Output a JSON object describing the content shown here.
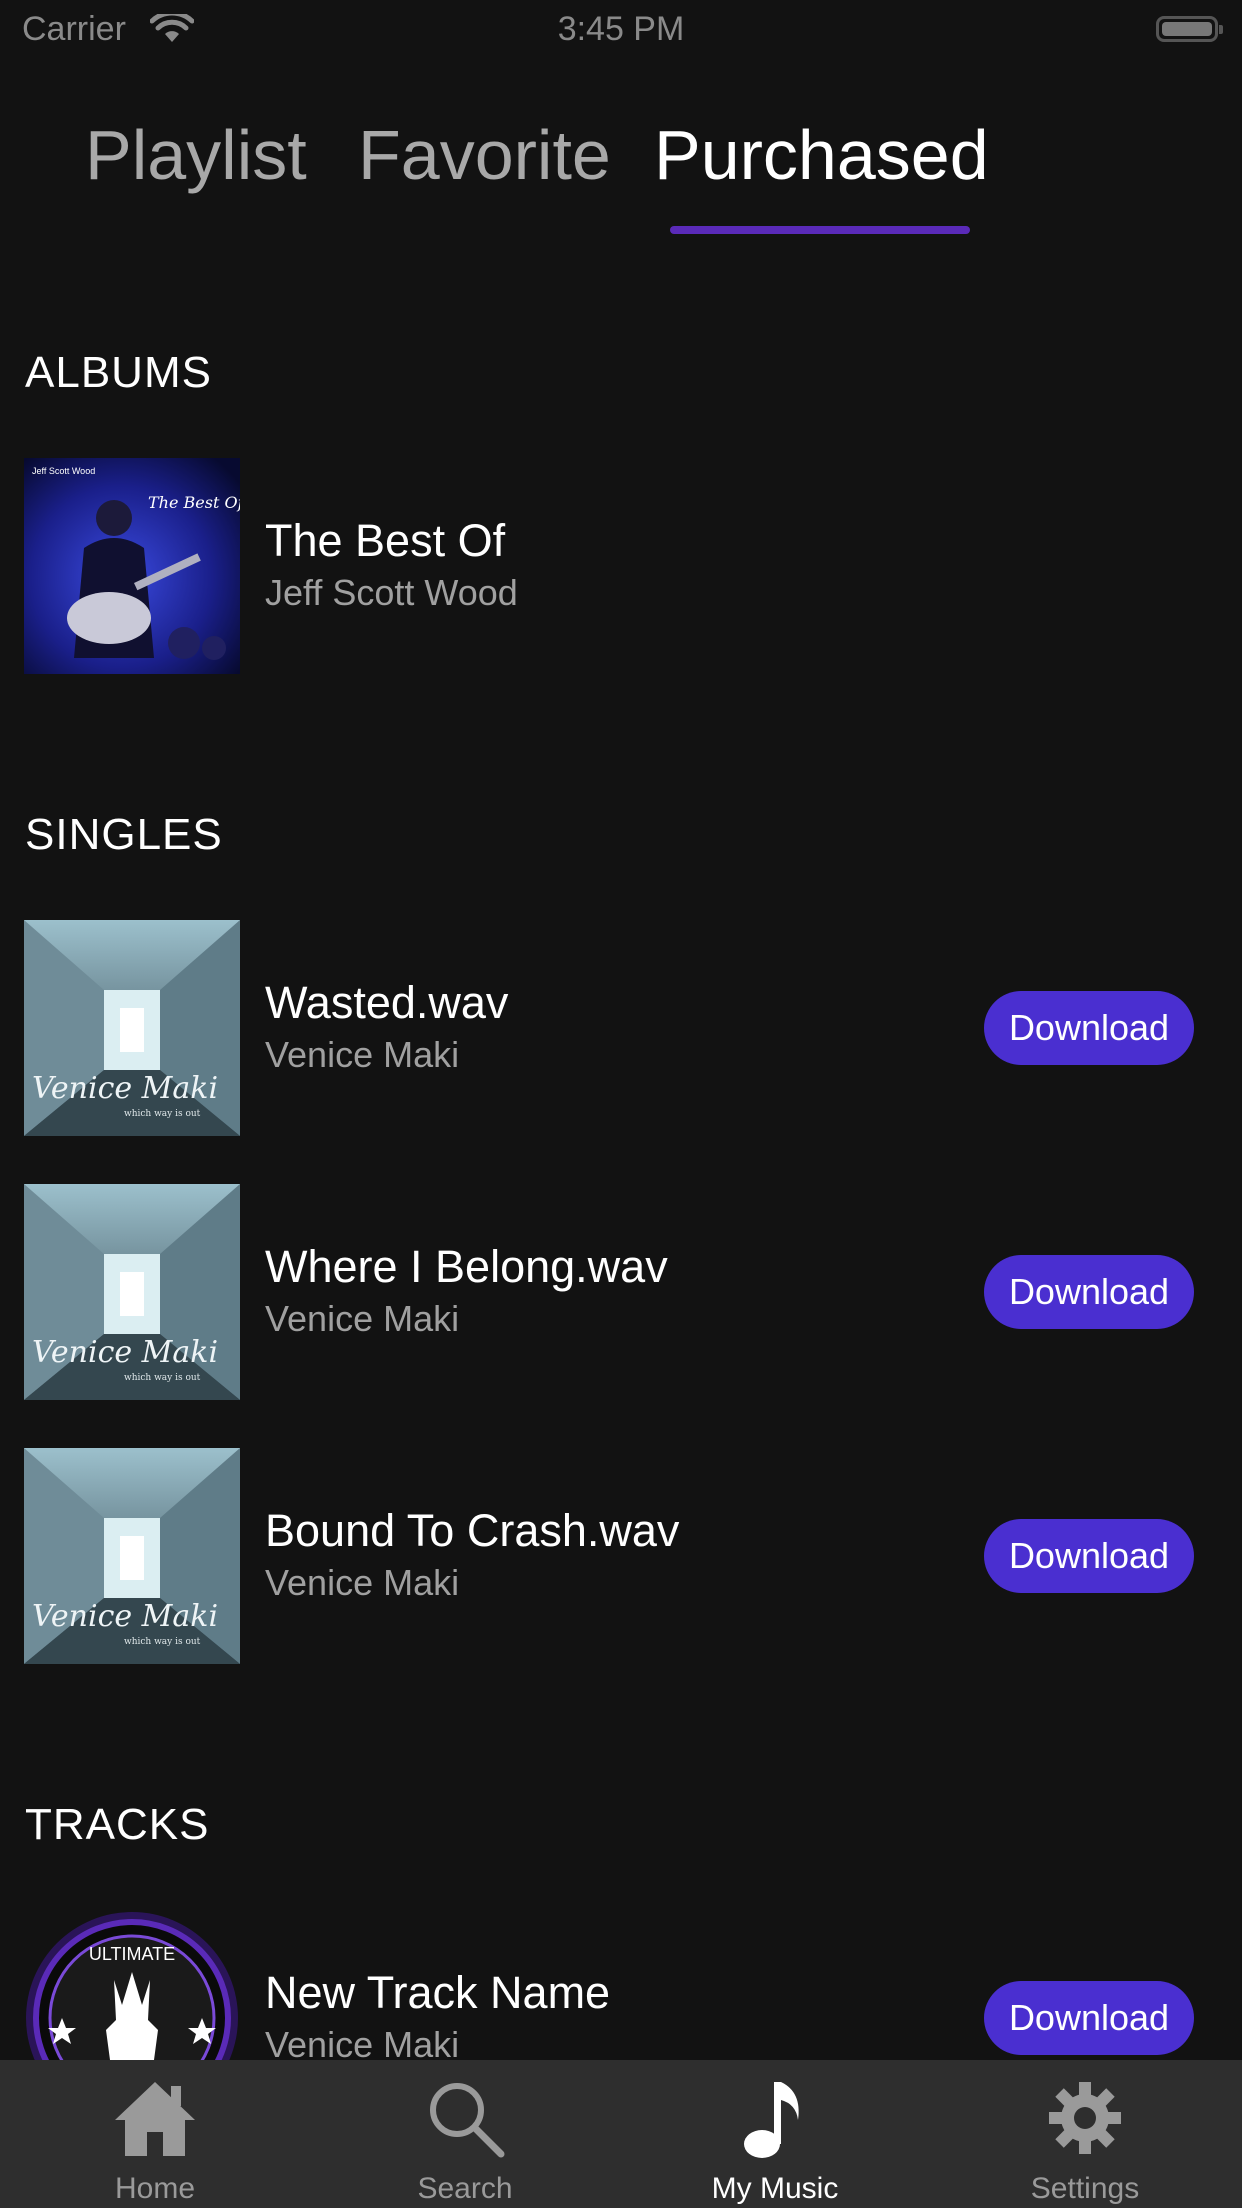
{
  "status_bar": {
    "carrier": "Carrier",
    "time": "3:45 PM"
  },
  "tabs": [
    {
      "label": "Playlist",
      "active": false
    },
    {
      "label": "Favorite",
      "active": false
    },
    {
      "label": "Purchased",
      "active": true
    }
  ],
  "sections": {
    "albums": {
      "title": "ALBUMS",
      "items": [
        {
          "title": "The Best Of",
          "artist": "Jeff Scott Wood",
          "cover_text_top": "Jeff Scott Wood",
          "cover_text_main": "The Best Of"
        }
      ]
    },
    "singles": {
      "title": "SINGLES",
      "items": [
        {
          "title": "Wasted.wav",
          "artist": "Venice Maki",
          "cover_text": "Venice Maki",
          "cover_subtext": "which way is out",
          "button": "Download"
        },
        {
          "title": "Where I Belong.wav",
          "artist": "Venice Maki",
          "cover_text": "Venice Maki",
          "cover_subtext": "which way is out",
          "button": "Download"
        },
        {
          "title": "Bound To Crash.wav",
          "artist": "Venice Maki",
          "cover_text": "Venice Maki",
          "cover_subtext": "which way is out",
          "button": "Download"
        }
      ]
    },
    "tracks": {
      "title": "TRACKS",
      "items": [
        {
          "title": "New Track Name",
          "artist": "Venice Maki",
          "badge_text": "ULTIMATE",
          "button": "Download"
        }
      ]
    }
  },
  "tab_bar": [
    {
      "label": "Home",
      "icon": "home-icon",
      "active": false
    },
    {
      "label": "Search",
      "icon": "search-icon",
      "active": false
    },
    {
      "label": "My Music",
      "icon": "music-note-icon",
      "active": true
    },
    {
      "label": "Settings",
      "icon": "gear-icon",
      "active": false
    }
  ],
  "colors": {
    "background": "#121212",
    "accent": "#4a2fd0",
    "tab_underline": "#5a2ab8",
    "tab_bar": "#2e2e2e"
  }
}
